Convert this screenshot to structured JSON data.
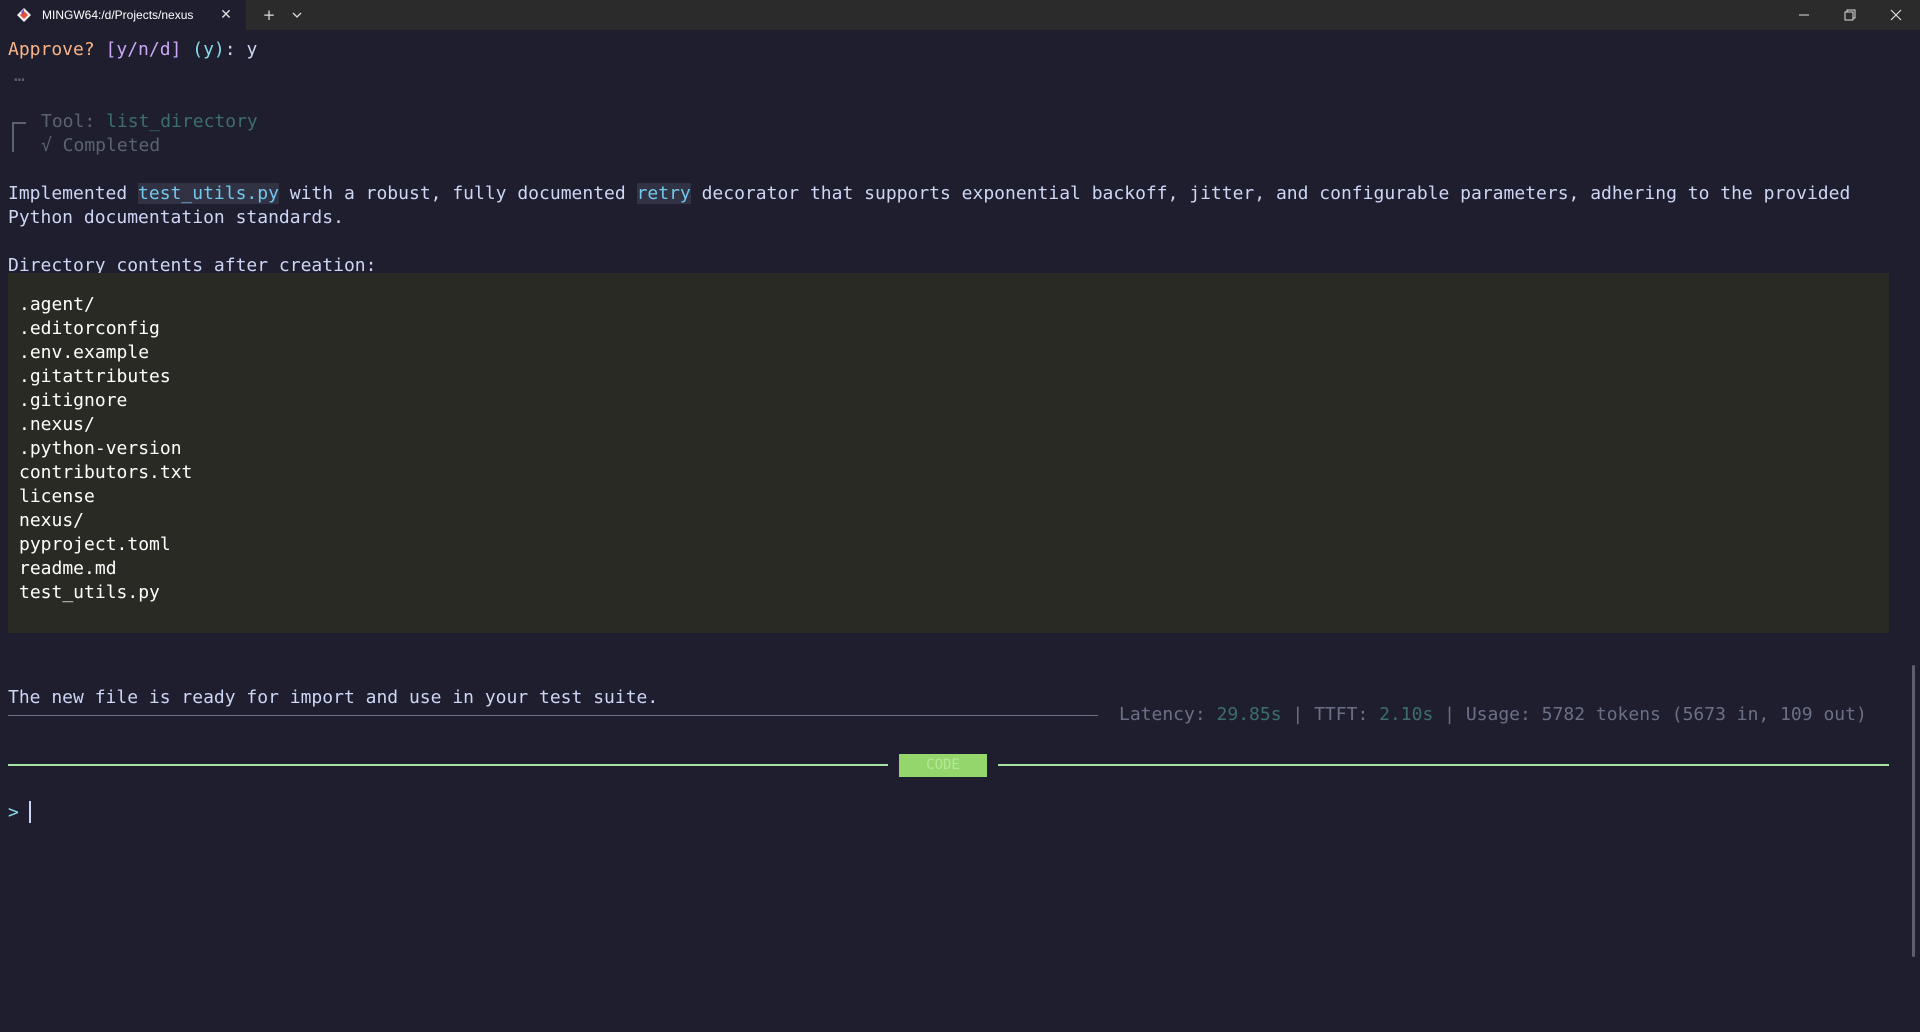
{
  "window": {
    "tab_title": "MINGW64:/d/Projects/nexus",
    "tab_close_glyph": "✕",
    "new_tab_glyph": "+",
    "dropdown_glyph": "⌄"
  },
  "terminal": {
    "approve": {
      "prompt": "Approve?",
      "options": "[y/n/d]",
      "default": "(y)",
      "colon": ":",
      "answer": "y"
    },
    "ellipsis": "…",
    "tool": {
      "label": "Tool:",
      "name": "list_directory",
      "status": "√ Completed"
    },
    "summary": {
      "part1": "Implemented ",
      "file_highlight": "test_utils.py",
      "part2": " with a robust, fully documented ",
      "retry_highlight": "retry",
      "part3": " decorator that supports exponential backoff, jitter, and configurable parameters, adhering to the provided",
      "line2": "Python documentation standards."
    },
    "directory_heading": "Directory contents after creation:",
    "directory_entries": [
      ".agent/",
      ".editorconfig",
      ".env.example",
      ".gitattributes",
      ".gitignore",
      ".nexus/",
      ".python-version",
      "contributors.txt",
      "license",
      "nexus/",
      "pyproject.toml",
      "readme.md",
      "test_utils.py"
    ],
    "closing_message": "The new file is ready for import and use in your test suite.",
    "stats": {
      "latency_label": "Latency: ",
      "latency_value": "29.85s",
      "sep1": " | ",
      "ttft_label": "TTFT: ",
      "ttft_value": "2.10s",
      "sep2": " | ",
      "usage": "Usage: 5782 tokens (5673 in, 109 out)"
    },
    "mode_badge": "CODE",
    "prompt_symbol": ">"
  },
  "colors": {
    "background": "#1e1e2e",
    "accent_green": "#a6e3a1",
    "badge_green": "#94d66c",
    "orange": "#fab387",
    "purple": "#cba6f7",
    "cyan": "#89dceb"
  }
}
